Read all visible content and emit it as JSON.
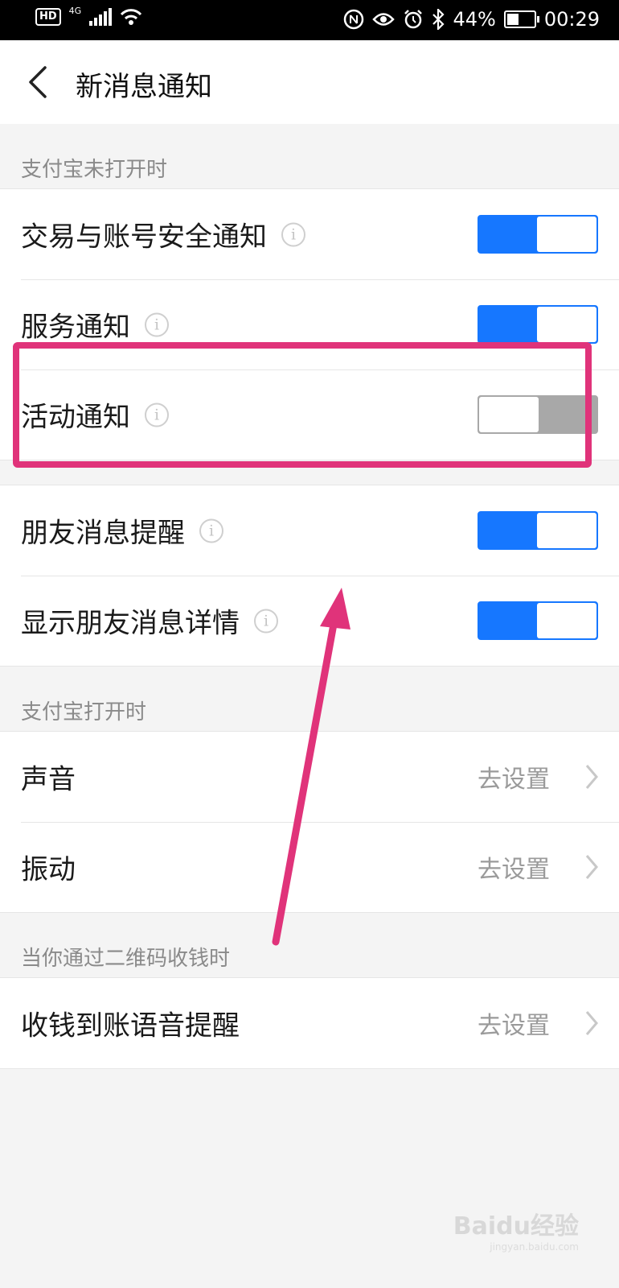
{
  "status_bar": {
    "left_badges": [
      "HD",
      "4G"
    ],
    "battery": "44%",
    "time": "00:29",
    "icons": [
      "nfc-icon",
      "eye-icon",
      "alarm-icon",
      "bluetooth-icon",
      "battery-icon",
      "signal-icon",
      "wifi-icon"
    ]
  },
  "header": {
    "title": "新消息通知",
    "back_icon": "chevron-left-icon"
  },
  "sections": [
    {
      "title": "支付宝未打开时",
      "rows": [
        {
          "label": "交易与账号安全通知",
          "toggle": true
        },
        {
          "label": "服务通知",
          "toggle": true
        },
        {
          "label": "活动通知",
          "toggle": false
        },
        {
          "label": "朋友消息提醒",
          "toggle": true
        },
        {
          "label": "显示朋友消息详情",
          "toggle": true
        }
      ]
    },
    {
      "title": "支付宝打开时",
      "rows": [
        {
          "label": "声音",
          "action": "去设置"
        },
        {
          "label": "振动",
          "action": "去设置"
        }
      ]
    },
    {
      "title": "当你通过二维码收钱时",
      "rows": [
        {
          "label": "收钱到账语音提醒",
          "action": "去设置"
        }
      ]
    }
  ],
  "watermark": {
    "brand": "Baidu经验",
    "url": "jingyan.baidu.com"
  },
  "colors": {
    "toggle_on": "#1677ff",
    "toggle_off": "#a8a8a8",
    "annotation": "#e0337a"
  }
}
